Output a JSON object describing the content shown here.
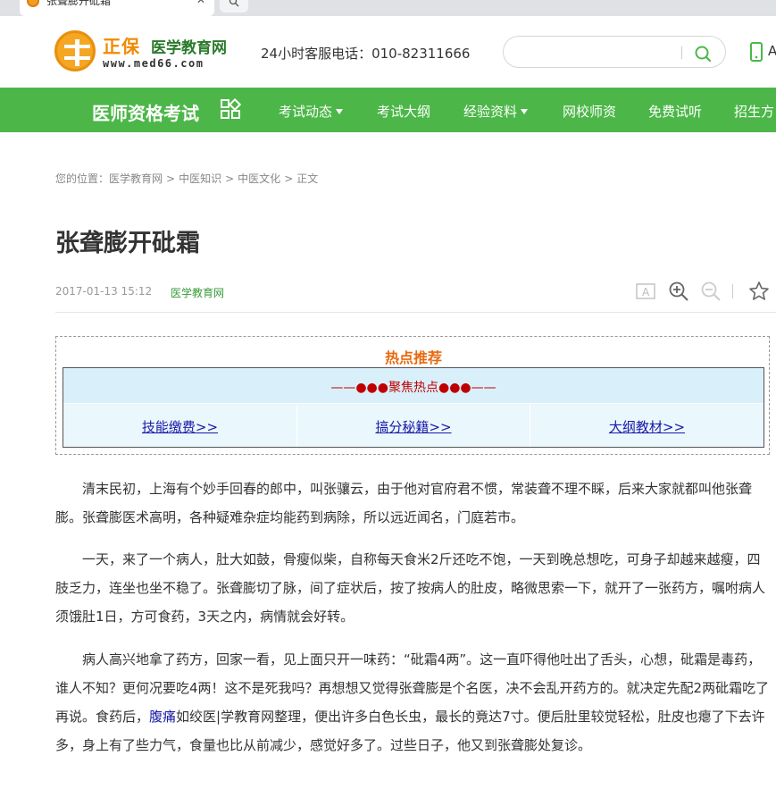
{
  "browser": {
    "tab_title": "张聋膨开砒霜",
    "tab_close": "✕"
  },
  "header": {
    "logo_brand": "正保",
    "logo_site": "医学教育网",
    "logo_url": "www.med66.com",
    "hotline": "24小时客服电话：010-82311666",
    "search_placeholder": "",
    "app_label": "A"
  },
  "nav": {
    "title": "医师资格考试",
    "items": [
      {
        "label": "考试动态",
        "has_caret": true
      },
      {
        "label": "考试大纲",
        "has_caret": false
      },
      {
        "label": "经验资料",
        "has_caret": true
      },
      {
        "label": "网校师资",
        "has_caret": false
      },
      {
        "label": "免费试听",
        "has_caret": false
      },
      {
        "label": "招生方",
        "has_caret": false
      }
    ]
  },
  "breadcrumb": {
    "prefix": "您的位置：",
    "items": [
      "医学教育网",
      "中医知识",
      "中医文化",
      "正文"
    ],
    "separator": ">"
  },
  "article": {
    "title": "张聋膨开砒霜",
    "date": "2017-01-13 15:12",
    "source": "医学教育网",
    "tools": [
      "font-size-icon",
      "zoom-in-icon",
      "zoom-out-icon",
      "star-icon"
    ]
  },
  "hot": {
    "title": "热点推荐",
    "banner": "——●●●聚焦热点●●●——",
    "links": [
      "技能缴费>>",
      "搞分秘籍>>",
      "大纲教材>>"
    ]
  },
  "paragraphs": {
    "p1": "清末民初，上海有个妙手回春的郎中，叫张骧云，由于他对官府君不惯，常装聋不理不睬，后来大家就都叫他张聋膨。张聋膨医术高明，各种疑难杂症均能药到病除，所以远近闻名，门庭若市。",
    "p2": "一天，来了一个病人，肚大如鼓，骨瘦似柴，自称每天食米2斤还吃不饱，一天到晚总想吃，可身子却越来越瘦，四肢乏力，连坐也坐不稳了。张聋膨切了脉，间了症状后，按了按病人的肚皮，略微思索一下，就开了一张药方，嘱咐病人须饿肚1日，方可食药，3天之内，病情就会好转。",
    "p3_a": "病人高兴地拿了药方，回家一看，见上面只开一味药：“砒霜4两”。这一直吓得他吐出了舌头，心想，砒霜是毒药，谁人不知？更何况要吃4两！这不是死我吗？再想想又觉得张聋膨是个名医，决不会乱开药方的。就决定先配2两砒霜吃了再说。食药后，",
    "p3_kw": "腹痛",
    "p3_b": "如绞医|学教育网整理，便出许多白色长虫，最长的竟达7寸。便后肚里较觉轻松，肚皮也瘪了下去许多，身上有了些力气，食量也比从前减少，感觉好多了。过些日子，他又到张聋膨处复诊。"
  },
  "colors": {
    "nav_green": "#4cb748",
    "hot_orange": "#e86a10",
    "hot_red": "#c00000",
    "link_blue": "#1a1aa6"
  }
}
